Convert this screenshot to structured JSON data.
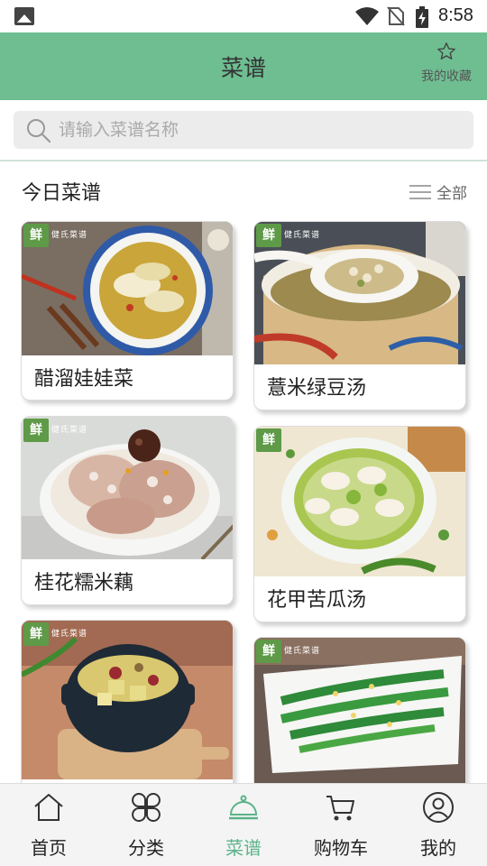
{
  "status_bar": {
    "time": "8:58"
  },
  "header": {
    "title": "菜谱",
    "favorites_label": "我的收藏"
  },
  "search": {
    "placeholder": "请输入菜谱名称",
    "value": ""
  },
  "section": {
    "title": "今日菜谱",
    "all_label": "全部"
  },
  "recipes": [
    {
      "name": "醋溜娃娃菜"
    },
    {
      "name": "薏米绿豆汤"
    },
    {
      "name": "桂花糯米藕"
    },
    {
      "name": "花甲苦瓜汤"
    },
    {
      "name": ""
    },
    {
      "name": ""
    }
  ],
  "badge": {
    "mark": "鲜",
    "text": "健氏菜谱"
  },
  "bottom_nav": [
    {
      "label": "首页",
      "icon": "home-icon"
    },
    {
      "label": "分类",
      "icon": "category-icon"
    },
    {
      "label": "菜谱",
      "icon": "cloche-icon",
      "active": true
    },
    {
      "label": "购物车",
      "icon": "cart-icon"
    },
    {
      "label": "我的",
      "icon": "user-icon"
    }
  ],
  "colors": {
    "header": "#6ebe91",
    "active_tab": "#5bb38a"
  }
}
